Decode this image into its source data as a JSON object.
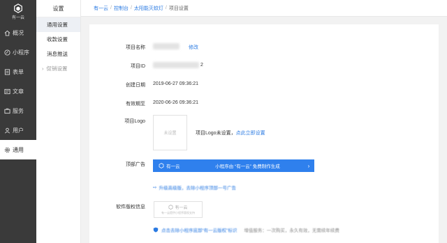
{
  "brand": {
    "logo_text": "有一云"
  },
  "leftnav": {
    "items": [
      {
        "label": "概况",
        "icon": "home-icon"
      },
      {
        "label": "小程序",
        "icon": "mini-program-icon"
      },
      {
        "label": "表单",
        "icon": "form-icon"
      },
      {
        "label": "文章",
        "icon": "article-icon"
      },
      {
        "label": "服务",
        "icon": "service-icon"
      },
      {
        "label": "用户",
        "icon": "user-icon"
      },
      {
        "label": "通用",
        "icon": "gear-icon"
      }
    ]
  },
  "subnav": {
    "title": "设置",
    "items": [
      "通用设置",
      "收款设置",
      "消息推送"
    ],
    "group": "促销设置"
  },
  "breadcrumb": [
    "有一云",
    "控制台",
    "太阳能灭蚊灯",
    "项目设置"
  ],
  "form": {
    "name_label": "项目名称",
    "edit_link": "修改",
    "id_label": "项目ID",
    "id_suffix": "2",
    "created_label": "创建日期",
    "created_value": "2019-06-27 09:36:21",
    "expiry_label": "有效期至",
    "expiry_value": "2020-06-26 09:36:21",
    "logo_label": "项目Logo",
    "logo_placeholder": "未设置",
    "logo_status": "项目Logo未设置，",
    "logo_link": "点此立即设置",
    "banner_label": "顶部广告",
    "banner_brand": "有一云",
    "banner_text": "小程序由 “有一云” 免费制作生成",
    "upgrade_text": "升级高级版，去除小程序顶部一号广告",
    "copyright_label": "软件版权信息",
    "copyright_brand": "有一云",
    "copyright_sub": "有一云提供小程序版权支持",
    "notice_text": "点击去除小程序底部“有一云版权”标识",
    "notice_gray": "增值服务：一次购买，永久有效，无需续年续费"
  },
  "colors": {
    "accent": "#2a7ae2",
    "banner": "#2f80ed",
    "sidebar": "#3a3a3a"
  }
}
